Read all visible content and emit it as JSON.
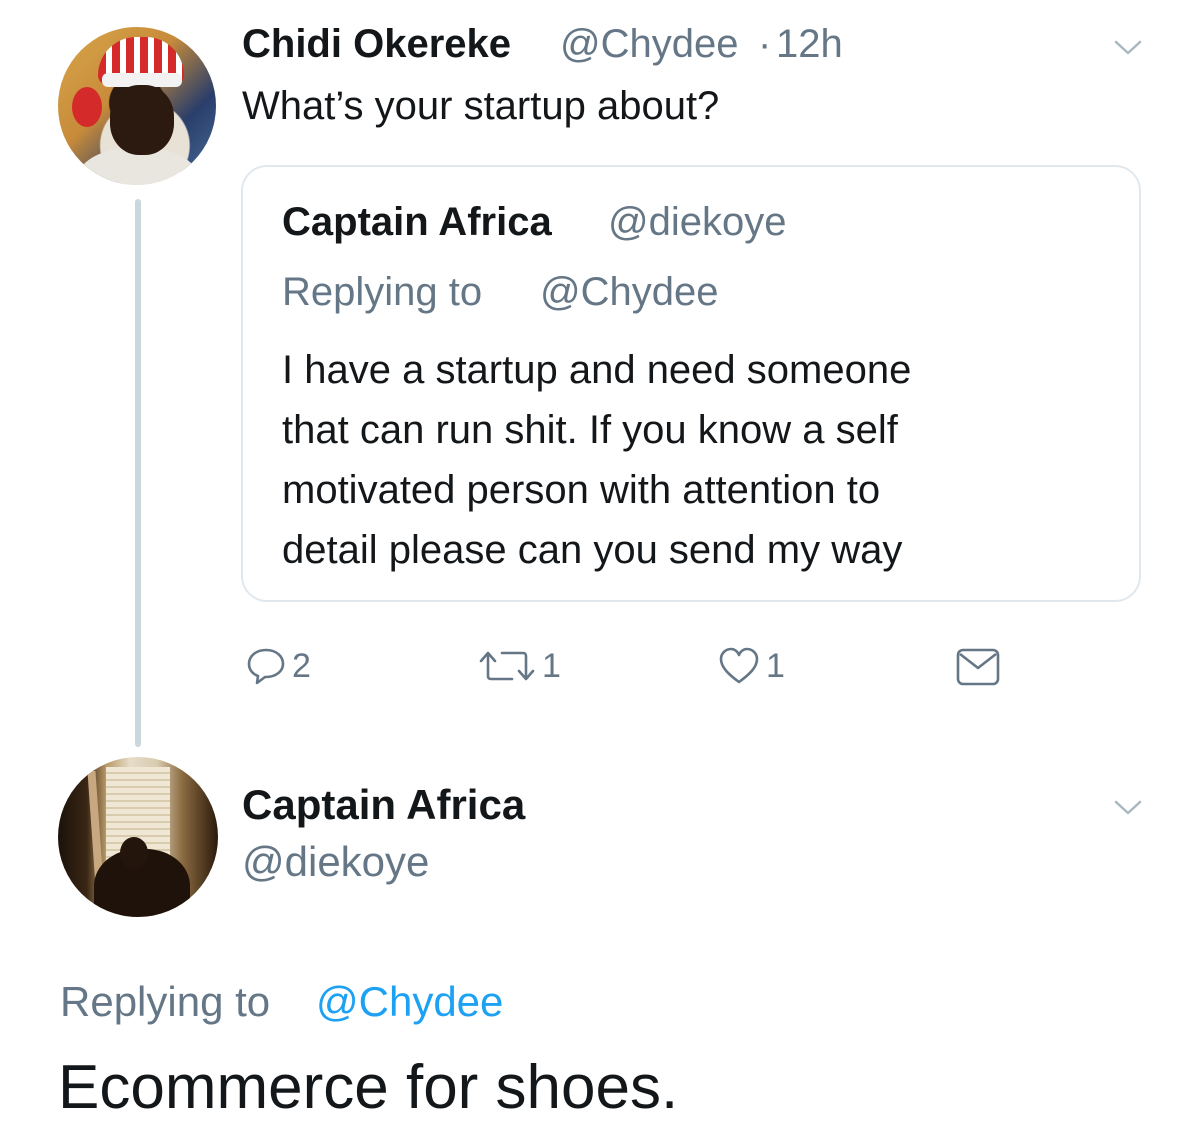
{
  "tweet1": {
    "name": "Chidi Okereke",
    "handle": "@Chydee",
    "dot": "·",
    "time": "12h",
    "text": "What’s your startup about?"
  },
  "quoted": {
    "name": "Captain Africa",
    "handle": "@diekoye",
    "reply_prefix": "Replying to",
    "reply_handle": "@Chydee",
    "body_lines": [
      "I have a startup and need someone",
      "that can run shit. If you know a self",
      "motivated person with attention to",
      "detail please can you send my way"
    ]
  },
  "actions": {
    "reply_count": "2",
    "retweet_count": "1",
    "like_count": "1",
    "icons": [
      "reply-icon",
      "retweet-icon",
      "like-icon",
      "direct-message-icon"
    ]
  },
  "tweet2": {
    "name": "Captain Africa",
    "handle": "@diekoye",
    "reply_prefix": "Replying to",
    "reply_handle": "@Chydee",
    "text": "Ecommerce for shoes."
  },
  "colors": {
    "text": "#14171a",
    "muted": "#657786",
    "link": "#1da1f2",
    "border": "#e1e8ed",
    "thread": "#ccd6dd"
  }
}
